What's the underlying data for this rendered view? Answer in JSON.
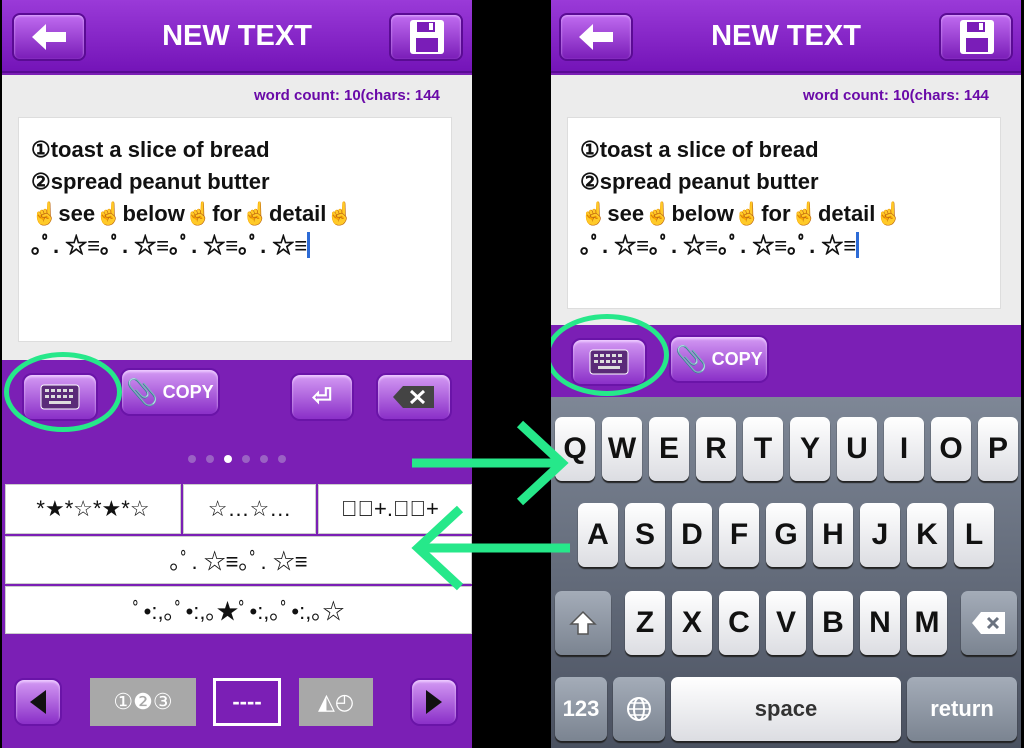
{
  "nav": {
    "title": "NEW TEXT"
  },
  "word_count": "word count: 10(chars: 144",
  "text_lines": [
    "①toast a slice of bread",
    "②spread peanut butter",
    "☝see☝below☝for☝detail☝",
    "｡ﾟ. ☆≡｡ﾟ. ☆≡｡ﾟ. ☆≡｡ﾟ. ☆≡"
  ],
  "toolbar": {
    "copy_label": "COPY"
  },
  "page_dots": {
    "count": 6,
    "active_index": 2
  },
  "symbol_grid": {
    "row1": [
      "*★*☆*★*☆",
      "☆…☆…",
      "☆ﾟ+.☆ﾟ+"
    ],
    "row2": "｡ﾟ. ☆≡｡ﾟ. ☆≡",
    "row3": "ﾟ•:,｡ﾟ•:,｡★ﾟ•:,｡ﾟ•:,｡☆"
  },
  "bottombar": {
    "tab1": "①❷③",
    "tab2": "----",
    "tab3": "◭◴"
  },
  "keyboard": {
    "row1": [
      "Q",
      "W",
      "E",
      "R",
      "T",
      "Y",
      "U",
      "I",
      "O",
      "P"
    ],
    "row2": [
      "A",
      "S",
      "D",
      "F",
      "G",
      "H",
      "J",
      "K",
      "L"
    ],
    "row3": [
      "Z",
      "X",
      "C",
      "V",
      "B",
      "N",
      "M"
    ],
    "num_label": "123",
    "space_label": "space",
    "return_label": "return"
  },
  "colors": {
    "accent": "#7b1fb5",
    "highlight_ring": "#26e88a",
    "caret": "#2d6bd6"
  }
}
